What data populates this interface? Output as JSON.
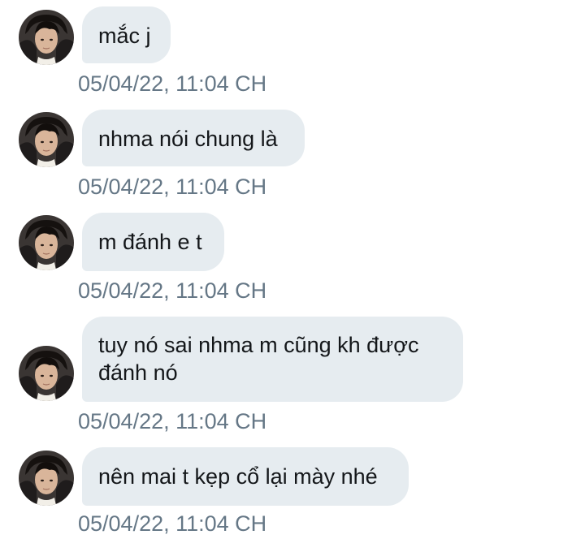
{
  "conversation": {
    "messages": [
      {
        "text": "mắc j",
        "timestamp": "05/04/22, 11:04 CH"
      },
      {
        "text": "nhma nói chung là",
        "timestamp": "05/04/22, 11:04 CH"
      },
      {
        "text": "m đánh e t",
        "timestamp": "05/04/22, 11:04 CH"
      },
      {
        "text": "tuy nó sai nhma m cũng kh được\nđánh nó",
        "timestamp": "05/04/22, 11:04 CH"
      },
      {
        "text": "nên mai t kẹp cổ lại mày nhé",
        "timestamp": "05/04/22, 11:04 CH"
      }
    ]
  },
  "colors": {
    "bubble_background": "#e6ecf0",
    "message_text": "#14171a",
    "timestamp_text": "#657786",
    "page_background": "#ffffff"
  },
  "icons": {
    "avatar": "user-avatar-photo"
  }
}
